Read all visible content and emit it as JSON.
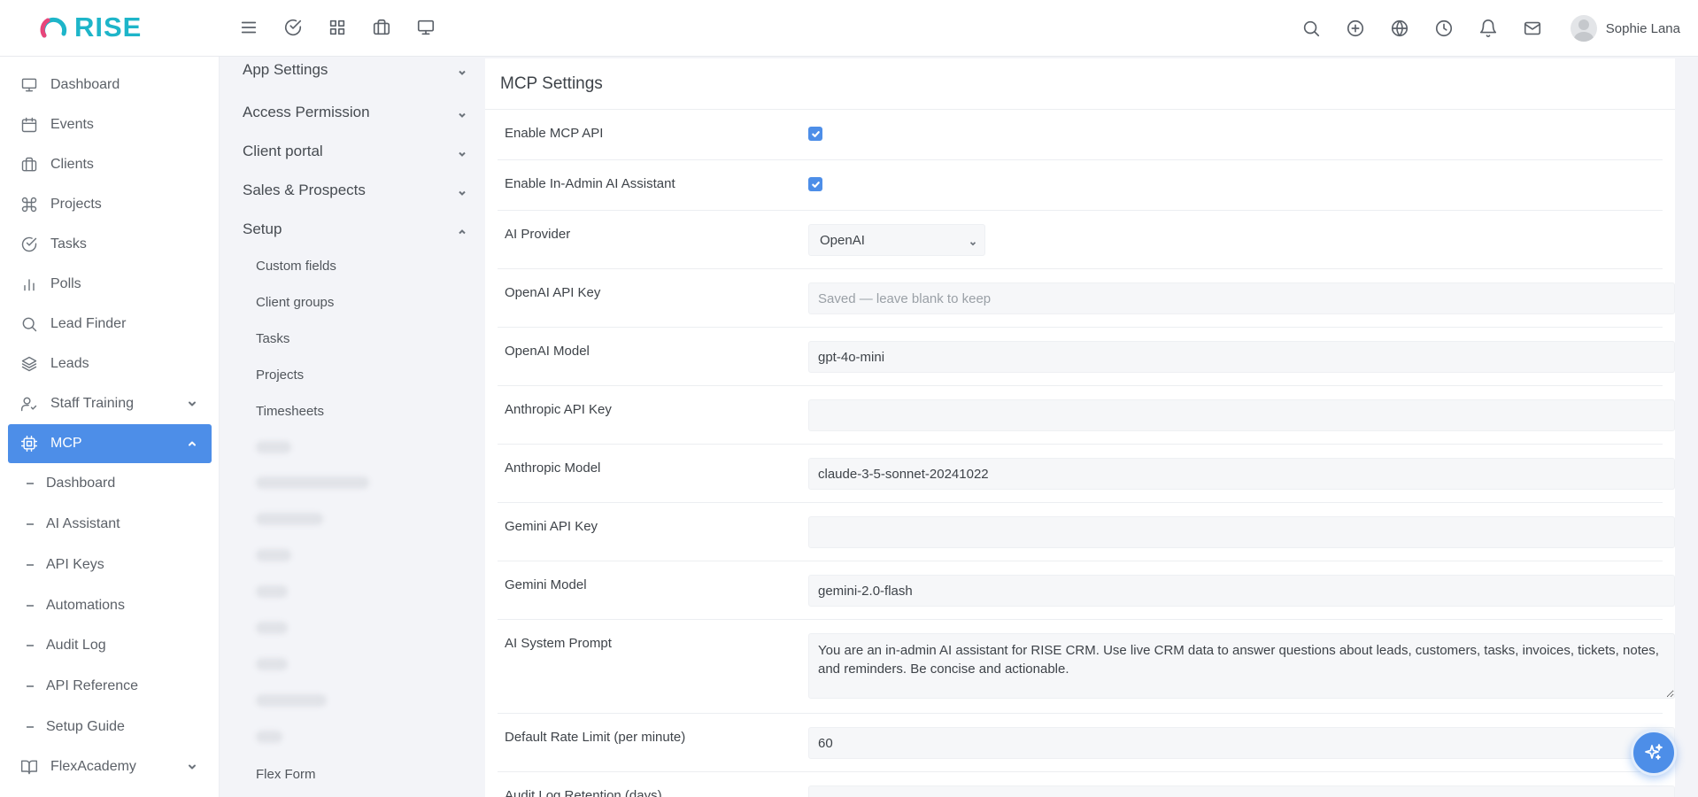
{
  "app": {
    "brand": "RISE",
    "accent": "#4d8ee8",
    "brand_color": "#1eb5c9"
  },
  "topbar": {
    "tools": [
      "menu-icon",
      "check-circle-icon",
      "grid-icon",
      "briefcase-icon",
      "monitor-icon"
    ],
    "right_icons": [
      "search-icon",
      "plus-circle-icon",
      "globe-icon",
      "clock-icon",
      "bell-icon",
      "mail-icon"
    ],
    "user_name": "Sophie Lana"
  },
  "sidebar": {
    "items": [
      {
        "label": "Dashboard",
        "icon": "monitor-icon"
      },
      {
        "label": "Events",
        "icon": "calendar-icon"
      },
      {
        "label": "Clients",
        "icon": "briefcase-icon"
      },
      {
        "label": "Projects",
        "icon": "command-icon"
      },
      {
        "label": "Tasks",
        "icon": "check-circle-icon"
      },
      {
        "label": "Polls",
        "icon": "bar-chart-icon"
      },
      {
        "label": "Lead Finder",
        "icon": "search-icon"
      },
      {
        "label": "Leads",
        "icon": "layers-icon"
      },
      {
        "label": "Staff Training",
        "icon": "user-check-icon"
      },
      {
        "label": "MCP",
        "icon": "cpu-icon"
      }
    ],
    "mcp_sub": [
      "Dashboard",
      "AI Assistant",
      "API Keys",
      "Automations",
      "Audit Log",
      "API Reference",
      "Setup Guide"
    ],
    "bottom_item": {
      "label": "FlexAcademy",
      "icon": "book-open-icon"
    }
  },
  "settings_menu": {
    "sections": [
      "App Settings",
      "Access Permission",
      "Client portal",
      "Sales & Prospects",
      "Setup"
    ],
    "setup_items": [
      "Custom fields",
      "Client groups",
      "Tasks",
      "Projects",
      "Timesheets"
    ],
    "last_item": "Flex Form"
  },
  "main": {
    "title": "MCP Settings",
    "enable_mcp_label": "Enable MCP API",
    "enable_mcp": true,
    "enable_ai_label": "Enable In-Admin AI Assistant",
    "enable_ai": true,
    "provider_label": "AI Provider",
    "provider_value": "OpenAI",
    "openai_key_label": "OpenAI API Key",
    "openai_key_placeholder": "Saved — leave blank to keep",
    "openai_model_label": "OpenAI Model",
    "openai_model_value": "gpt-4o-mini",
    "anthropic_key_label": "Anthropic API Key",
    "anthropic_model_label": "Anthropic Model",
    "anthropic_model_value": "claude-3-5-sonnet-20241022",
    "gemini_key_label": "Gemini API Key",
    "gemini_model_label": "Gemini Model",
    "gemini_model_value": "gemini-2.0-flash",
    "system_prompt_label": "AI System Prompt",
    "system_prompt_value": "You are an in-admin AI assistant for RISE CRM. Use live CRM data to answer questions about leads, customers, tasks, invoices, tickets, notes, and reminders. Be concise and actionable.",
    "rate_limit_label": "Default Rate Limit (per minute)",
    "rate_limit_value": "60",
    "retention_label": "Audit Log Retention (days)"
  }
}
